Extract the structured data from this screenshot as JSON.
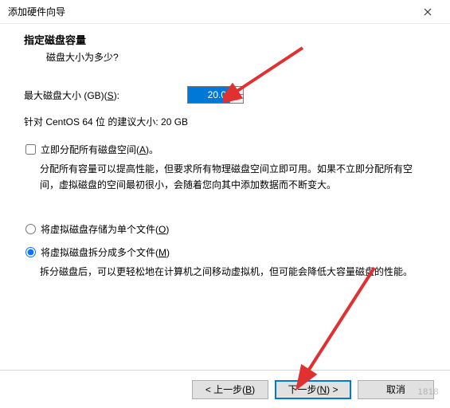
{
  "window": {
    "title": "添加硬件向导"
  },
  "header": {
    "heading": "指定磁盘容量",
    "sub": "磁盘大小为多少?"
  },
  "sizeRow": {
    "label": "最大磁盘大小 (GB)(",
    "mnemonic": "S",
    "labelEnd": "):",
    "value": "20.0"
  },
  "recommendation": "针对 CentOS 64 位 的建议大小: 20 GB",
  "allocateNow": {
    "label": "立即分配所有磁盘空间(",
    "mnemonic": "A",
    "labelEnd": ")。",
    "desc": "分配所有容量可以提高性能，但要求所有物理磁盘空间立即可用。如果不立即分配所有空间，虚拟磁盘的空间最初很小，会随着您向其中添加数据而不断变大。"
  },
  "storeSingle": {
    "label": "将虚拟磁盘存储为单个文件(",
    "mnemonic": "O",
    "labelEnd": ")"
  },
  "storeMulti": {
    "label": "将虚拟磁盘拆分成多个文件(",
    "mnemonic": "M",
    "labelEnd": ")",
    "desc": "拆分磁盘后，可以更轻松地在计算机之间移动虚拟机，但可能会降低大容量磁盘的性能。"
  },
  "footer": {
    "back": "< 上一步(",
    "backM": "B",
    "backEnd": ")",
    "next": "下一步(",
    "nextM": "N",
    "nextEnd": ") >",
    "cancel": "取消"
  },
  "watermark": "1818"
}
